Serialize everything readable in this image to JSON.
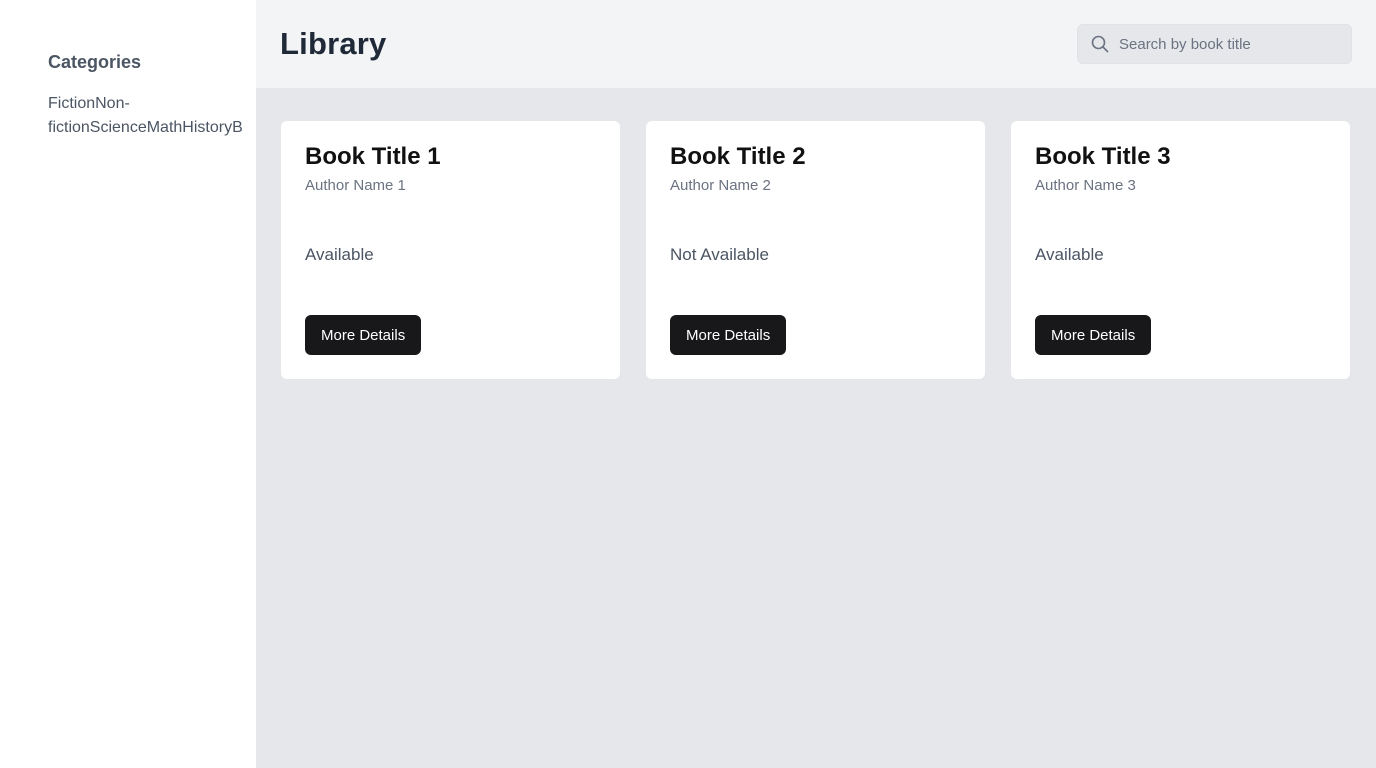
{
  "sidebar": {
    "title": "Categories",
    "categories": [
      "Fiction",
      "Non-fiction",
      "Science",
      "Math",
      "History",
      "B"
    ]
  },
  "header": {
    "title": "Library",
    "search": {
      "placeholder": "Search by book title",
      "value": ""
    }
  },
  "books": [
    {
      "title": "Book Title 1",
      "author": "Author Name 1",
      "availability": "Available",
      "button_label": "More Details"
    },
    {
      "title": "Book Title 2",
      "author": "Author Name 2",
      "availability": "Not Available",
      "button_label": "More Details"
    },
    {
      "title": "Book Title 3",
      "author": "Author Name 3",
      "availability": "Available",
      "button_label": "More Details"
    }
  ],
  "icons": {
    "search": "search-icon"
  },
  "colors": {
    "button_bg": "#18181b",
    "main_bg": "#e5e7eb",
    "header_bg": "#f3f4f6"
  }
}
